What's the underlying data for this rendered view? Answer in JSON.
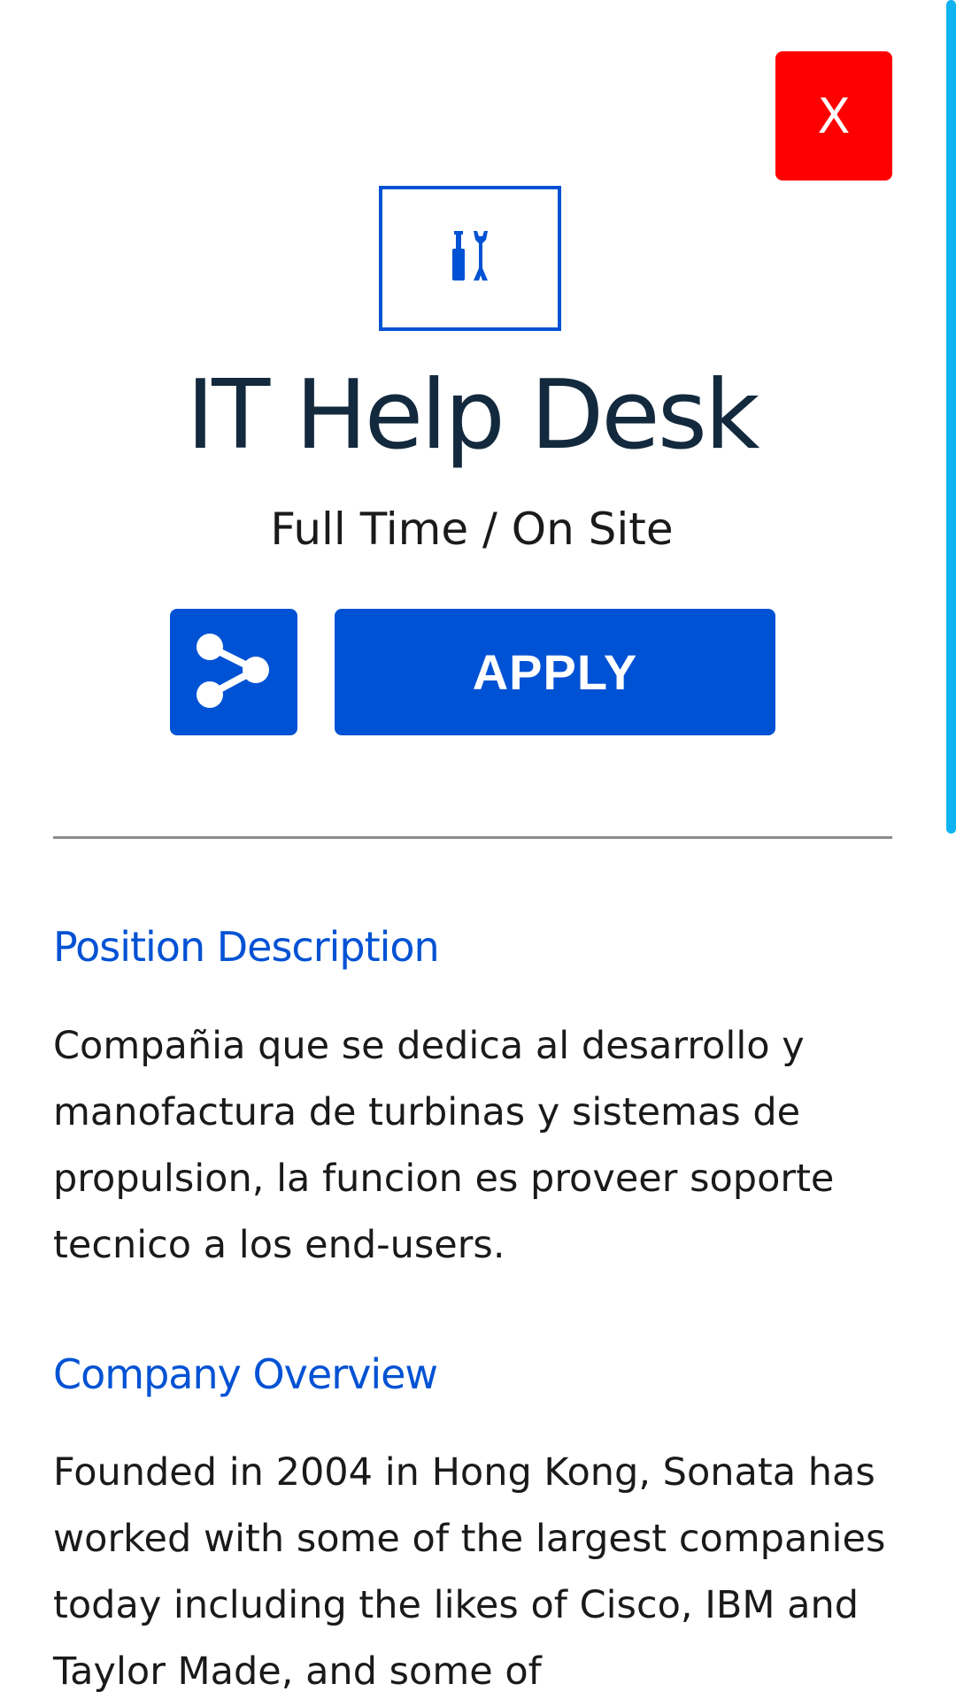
{
  "close_button": {
    "label": "X"
  },
  "job": {
    "icon": "tools-icon",
    "title": "IT Help Desk",
    "type": "Full Time / On Site"
  },
  "actions": {
    "share_icon": "share-icon",
    "apply_label": "APPLY"
  },
  "sections": {
    "position": {
      "heading": "Position Description",
      "body": "Compañia que se dedica al desarrollo y manofactura de turbinas y sistemas de propulsion, la funcion es proveer soporte tecnico a los end-users."
    },
    "company": {
      "heading": "Company Overview",
      "body": "Founded in 2004 in Hong Kong, Sonata has worked with some of the largest companies today including the likes of Cisco, IBM and Taylor Made, and some of"
    }
  },
  "colors": {
    "brand_blue": "#0052d4",
    "close_red": "#ff0000",
    "scrollbar": "#0fb3f2",
    "title_text": "#13293d"
  }
}
